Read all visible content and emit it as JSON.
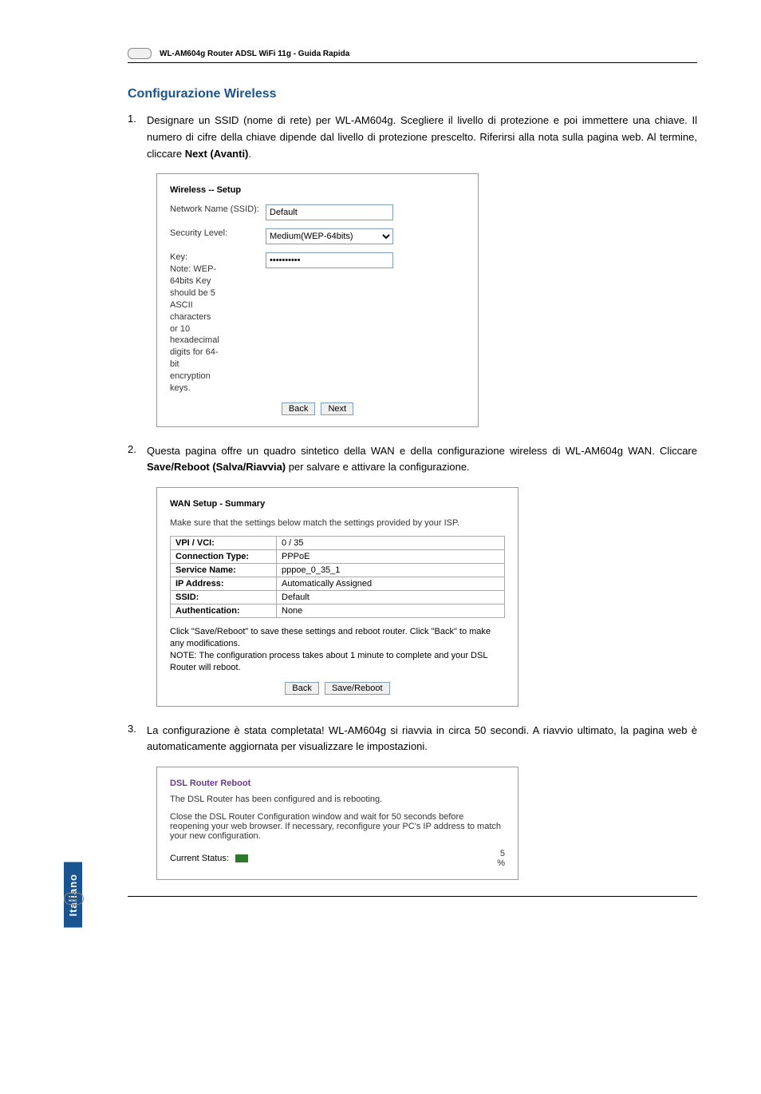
{
  "header": "WL-AM604g Router ADSL WiFi 11g - Guida Rapida",
  "section_title": "Configurazione Wireless",
  "steps": {
    "s1": {
      "num": "1.",
      "text": "Designare un SSID (nome di rete) per WL-AM604g. Scegliere il livello di protezione e poi immettere una chiave. Il numero di cifre della chiave dipende dal livello di protezione prescelto. Riferirsi alla nota sulla pagina web. Al termine, cliccare ",
      "bold": "Next (Avanti)",
      "tail": "."
    },
    "s2": {
      "num": "2.",
      "text": "Questa pagina offre un quadro sintetico della WAN e della configurazione wireless di WL-AM604g WAN. Cliccare ",
      "bold": "Save/Reboot (Salva/Riavvia)",
      "tail": " per salvare e attivare la configurazione."
    },
    "s3": {
      "num": "3.",
      "text": "La configurazione è stata completata! WL-AM604g si riavvia in circa 50 secondi. A riavvio ultimato, la pagina web è automaticamente aggiornata per visualizzare le impostazioni."
    }
  },
  "wireless_panel": {
    "title": "Wireless -- Setup",
    "ssid_label": "Network Name (SSID):",
    "ssid_value": "Default",
    "security_label": "Security Level:",
    "security_value": "Medium(WEP-64bits)",
    "key_label": "Key:",
    "key_value": "••••••••••",
    "note": "Note: WEP-\n64bits Key\nshould be 5\nASCII\ncharacters\nor 10\nhexadecimal\ndigits for 64-\nbit\nencryption\nkeys.",
    "btn_back": "Back",
    "btn_next": "Next"
  },
  "wan_panel": {
    "title": "WAN Setup - Summary",
    "subtext": "Make sure that the settings below match the settings provided by your ISP.",
    "rows": [
      {
        "k": "VPI / VCI:",
        "v": "0 / 35"
      },
      {
        "k": "Connection Type:",
        "v": "PPPoE"
      },
      {
        "k": "Service Name:",
        "v": "pppoe_0_35_1"
      },
      {
        "k": "IP Address:",
        "v": "Automatically Assigned"
      },
      {
        "k": "SSID:",
        "v": "Default"
      },
      {
        "k": "Authentication:",
        "v": "None"
      }
    ],
    "note": "Click \"Save/Reboot\" to save these settings and reboot router. Click \"Back\" to make any modifications.\nNOTE: The configuration process takes about 1 minute to complete and your DSL Router will reboot.",
    "btn_back": "Back",
    "btn_save": "Save/Reboot"
  },
  "reboot_panel": {
    "title": "DSL Router Reboot",
    "line1": "The DSL Router has been configured and is rebooting.",
    "line2": "Close the DSL Router Configuration window and wait for 50 seconds before reopening your web browser. If necessary, reconfigure your PC's IP address to match your new configuration.",
    "status_label": "Current Status:",
    "percent": "5\n%"
  },
  "side_tab": "Italiano",
  "page_number": "68"
}
